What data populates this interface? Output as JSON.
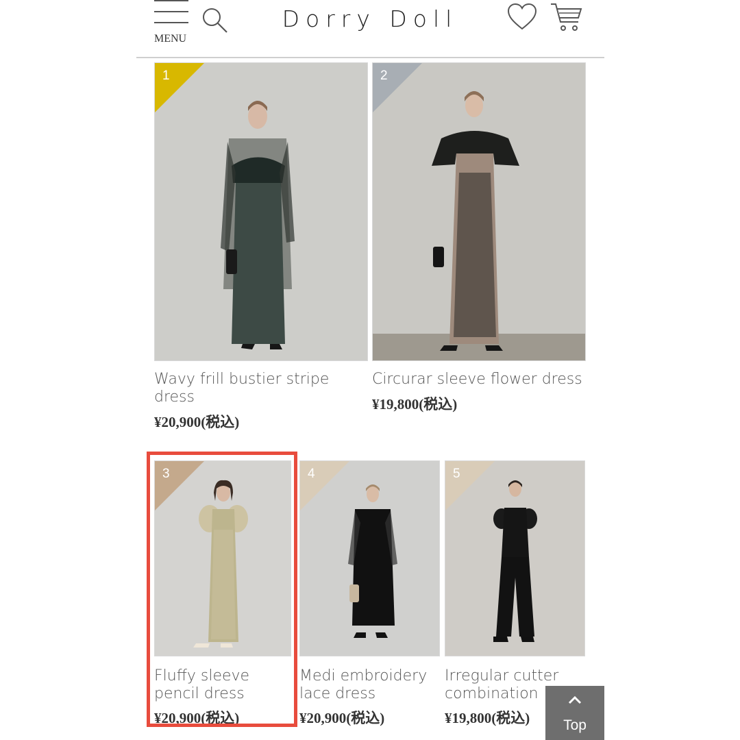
{
  "header": {
    "menu_label": "MENU",
    "logo": "Dorry Doll",
    "icons": [
      "menu-icon",
      "search-icon",
      "heart-icon",
      "cart-icon"
    ]
  },
  "products": [
    {
      "rank": "1",
      "rank_color": "#d8b800",
      "name": "Wavy frill bustier stripe\ndress",
      "price": "¥20,900(税込)"
    },
    {
      "rank": "2",
      "rank_color": "#a8aeb4",
      "name": "Circurar sleeve flower dress",
      "price": "¥19,800(税込)"
    },
    {
      "rank": "3",
      "rank_color": "#c4a98c",
      "name": "Fluffy sleeve\npencil dress",
      "price": "¥20,900(税込)"
    },
    {
      "rank": "4",
      "rank_color": "#d9ccb8",
      "name": "Medi embroidery\nlace dress",
      "price": "¥20,900(税込)"
    },
    {
      "rank": "5",
      "rank_color": "#d9ccb8",
      "name": "Irregular cutter\ncombination",
      "price": "¥19,800(税込)"
    }
  ],
  "highlight_color": "#e84c3d",
  "top_button": {
    "label": "Top"
  }
}
